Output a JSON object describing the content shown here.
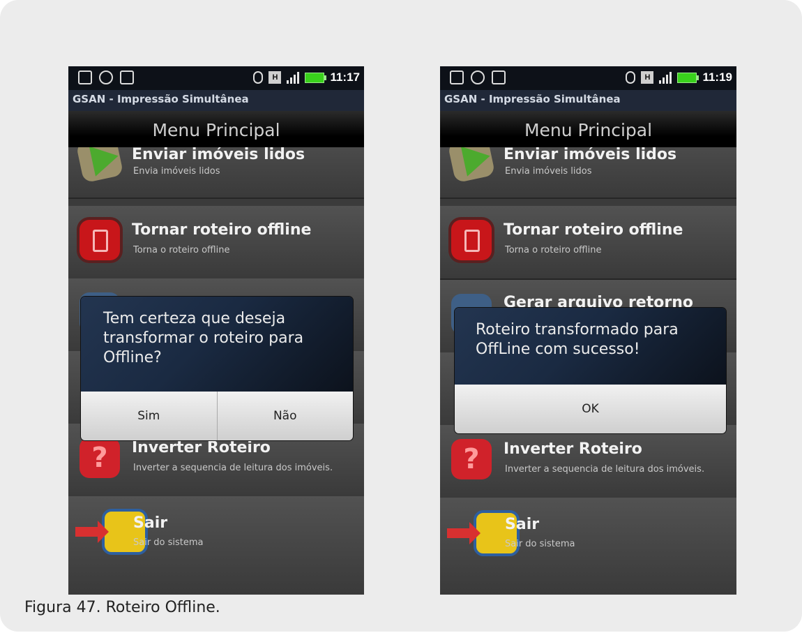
{
  "status_left": {
    "time": "11:17",
    "h_label": "H"
  },
  "status_right": {
    "time": "11:19",
    "h_label": "H"
  },
  "app_title": "GSAN - Impressão Simultânea",
  "menu_title": "Menu Principal",
  "items": {
    "enviar": {
      "title": "Enviar imóveis lidos",
      "sub": "Envia imóveis lidos"
    },
    "offline": {
      "title": "Tornar roteiro offline",
      "sub": "Torna o roteiro offline"
    },
    "gerar": {
      "title": "Gerar arquivo retorno"
    },
    "inverter": {
      "title": "Inverter Roteiro",
      "sub": "Inverter a sequencia de leitura dos imóveis."
    },
    "sair": {
      "title": "Sair",
      "sub": "Sair do sistema"
    }
  },
  "dialog_left": {
    "message": "Tem certeza que deseja transformar o roteiro para Offline?",
    "yes": "Sim",
    "no": "Não"
  },
  "dialog_right": {
    "message": "Roteiro transformado para OffLine com sucesso!",
    "ok": "OK"
  },
  "caption": "Figura 47. Roteiro Offline.",
  "colors": {
    "status_bar": "#0d1118",
    "app_bar": "#202838",
    "battery": "#39d11c",
    "list_bg": "#3b3b3b"
  }
}
